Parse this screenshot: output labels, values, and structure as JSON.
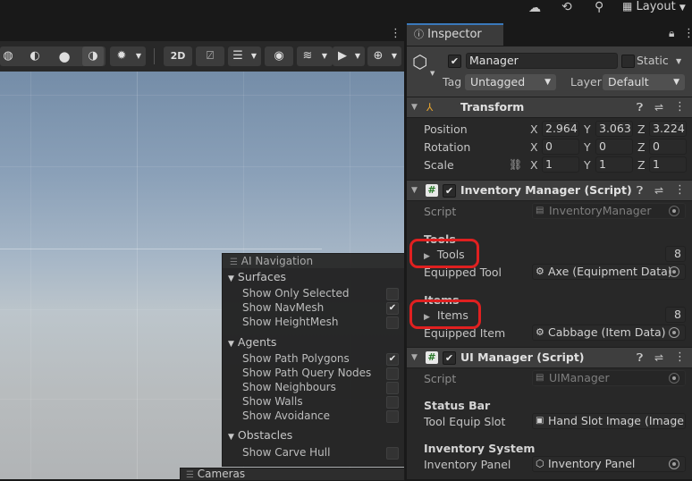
{
  "topbar": {
    "cloud_icon": "cloud-icon",
    "history_icon": "history-icon",
    "search_icon": "search-icon",
    "layout_label": "Layout"
  },
  "scene_toolbar": {
    "mode_2d": "2D"
  },
  "ai_navigation": {
    "title": "AI Navigation",
    "surfaces": {
      "label": "Surfaces",
      "items": [
        {
          "label": "Show Only Selected",
          "checked": false
        },
        {
          "label": "Show NavMesh",
          "checked": true
        },
        {
          "label": "Show HeightMesh",
          "checked": false
        }
      ]
    },
    "agents": {
      "label": "Agents",
      "items": [
        {
          "label": "Show Path Polygons",
          "checked": true
        },
        {
          "label": "Show Path Query Nodes",
          "checked": false
        },
        {
          "label": "Show Neighbours",
          "checked": false
        },
        {
          "label": "Show Walls",
          "checked": false
        },
        {
          "label": "Show Avoidance",
          "checked": false
        }
      ]
    },
    "obstacles": {
      "label": "Obstacles",
      "items": [
        {
          "label": "Show Carve Hull",
          "checked": false
        }
      ]
    }
  },
  "cameras_overlay": {
    "title": "Cameras"
  },
  "inspector": {
    "tab_label": "Inspector",
    "object": {
      "name": "Manager",
      "active": true,
      "static_label": "Static",
      "tag_label": "Tag",
      "tag_value": "Untagged",
      "layer_label": "Layer",
      "layer_value": "Default"
    },
    "transform": {
      "title": "Transform",
      "position_label": "Position",
      "rotation_label": "Rotation",
      "scale_label": "Scale",
      "position": {
        "x": "2.964",
        "y": "3.063",
        "z": "3.224"
      },
      "rotation": {
        "x": "0",
        "y": "0",
        "z": "0"
      },
      "scale": {
        "x": "1",
        "y": "1",
        "z": "1"
      }
    },
    "inventory_manager": {
      "title": "Inventory Manager (Script)",
      "script_label": "Script",
      "script_value": "InventoryManager",
      "tools_header": "Tools",
      "tools_label": "Tools",
      "tools_count": "8",
      "equipped_tool_label": "Equipped Tool",
      "equipped_tool_value": "Axe (Equipment Data)",
      "items_header": "Items",
      "items_label": "Items",
      "items_count": "8",
      "equipped_item_label": "Equipped Item",
      "equipped_item_value": "Cabbage (Item Data)"
    },
    "ui_manager": {
      "title": "UI Manager (Script)",
      "script_label": "Script",
      "script_value": "UIManager",
      "status_bar_header": "Status Bar",
      "tool_equip_slot_label": "Tool Equip Slot",
      "tool_equip_slot_value": "Hand Slot Image (Image",
      "inventory_system_header": "Inventory System",
      "inventory_panel_label": "Inventory Panel",
      "inventory_panel_value": "Inventory Panel"
    }
  },
  "colors": {
    "highlight": "#e02020",
    "accent": "#3a79bb"
  }
}
